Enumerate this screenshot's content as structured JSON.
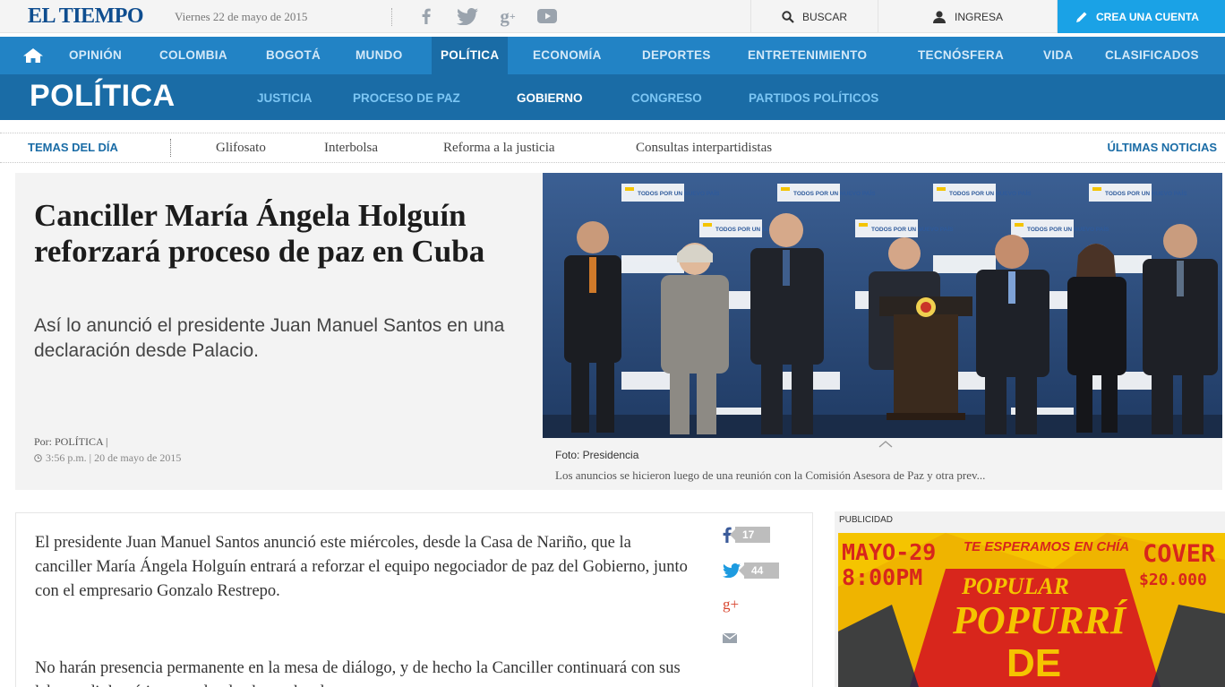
{
  "topbar": {
    "logo": "EL TIEMPO",
    "date": "Viernes 22 de mayo de 2015",
    "social_icons": [
      "facebook-icon",
      "twitter-icon",
      "google-plus-icon",
      "youtube-icon"
    ],
    "search_label": "BUSCAR",
    "login_label": "INGRESA",
    "create_account_label": "CREA UNA CUENTA"
  },
  "nav": {
    "items": [
      "OPINIÓN",
      "COLOMBIA",
      "BOGOTÁ",
      "MUNDO",
      "POLÍTICA",
      "ECONOMÍA",
      "DEPORTES",
      "ENTRETENIMIENTO",
      "TECNÓSFERA",
      "VIDA",
      "CLASIFICADOS"
    ],
    "active": "POLÍTICA"
  },
  "section": {
    "title": "POLÍTICA",
    "subitems": [
      "JUSTICIA",
      "PROCESO DE PAZ",
      "GOBIERNO",
      "CONGRESO",
      "PARTIDOS POLÍTICOS"
    ],
    "active": "GOBIERNO"
  },
  "trending": {
    "label": "TEMAS DEL DÍA",
    "items": [
      "Glifosato",
      "Interbolsa",
      "Reforma a la justicia",
      "Consultas interpartidistas"
    ],
    "latest_label": "ÚLTIMAS NOTICIAS"
  },
  "hero": {
    "title": "Canciller María Ángela Holguín reforzará proceso de paz en Cuba",
    "summary": "Así lo anunció el presidente Juan Manuel Santos en una declaración desde Palacio.",
    "byline": "Por: POLÍTICA |",
    "time": "3:56 p.m. | 20 de mayo de 2015",
    "photo_credit": "Foto: Presidencia",
    "photo_caption": "Los anuncios se hicieron luego de una reunión con la Comisión Asesora de Paz y otra prev...",
    "backdrop_text": "TODOS POR UN NUEVO PAÍS"
  },
  "article": {
    "paragraphs": [
      "El presidente Juan Manuel Santos anunció este miércoles, desde la Casa de Nariño, que la canciller María Ángela Holguín entrará a reforzar el equipo negociador de paz del Gobierno, junto con el empresario Gonzalo Restrepo.",
      "No harán presencia permanente en la mesa de diálogo, y de hecho la Canciller continuará con sus labores diplomáticas, en donde alterna las dos"
    ],
    "share": {
      "facebook_count": "17",
      "twitter_count": "44",
      "google_label": "g+"
    }
  },
  "ad": {
    "label": "PUBLICIDAD",
    "date_line1": "MAYO-29",
    "date_line2": "8:00PM",
    "slogan": "TE ESPERAMOS EN CHÍA",
    "cover_label": "COVER",
    "cover_price": "$20.000",
    "brand": "POPULAR",
    "title_line1": "POPURRÍ",
    "title_line2": "DE"
  },
  "colors": {
    "brand_blue": "#0e4d8f",
    "nav_blue": "#2283c5",
    "section_blue": "#1a6ca6",
    "accent_cyan": "#1aa2e6",
    "ad_yellow": "#f5c400",
    "ad_red": "#d8261c"
  }
}
